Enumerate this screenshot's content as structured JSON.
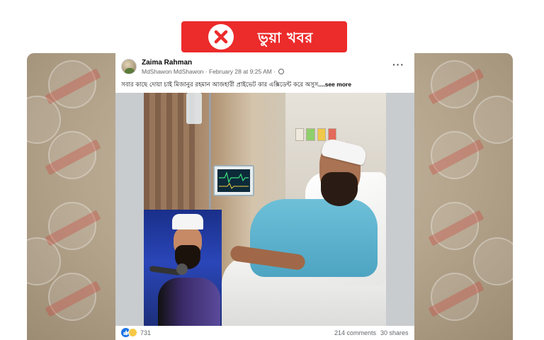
{
  "banner": {
    "label": "ভুয়া খবর",
    "icon": "x-icon",
    "color": "#ec2b2b"
  },
  "post": {
    "author": "Zaima Rahman",
    "sub_author": "MdShawon MdShawon",
    "timestamp": "February 28 at 9:25 AM",
    "separator": "·",
    "privacy_icon": "globe-icon",
    "more_label": "···",
    "caption": "সবার কাছে দোয়া চাই মিজানুর রহমান আজহারী প্রাইভেট কার এক্সিডেন্ট করে অসুস",
    "see_more": "....see more",
    "reaction_icons": [
      "like-icon",
      "sad-icon"
    ],
    "reactions_count": "731",
    "comments": "214 comments",
    "shares": "30 shares"
  },
  "colors": {
    "banner_red": "#ec2b2b",
    "facebook_blue": "#1b74e4",
    "meta_grey": "#65676b"
  }
}
